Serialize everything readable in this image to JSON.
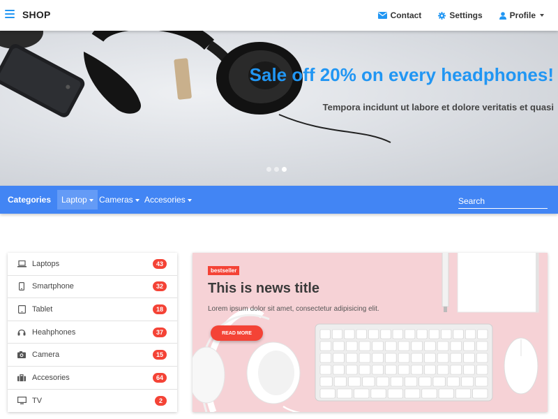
{
  "header": {
    "brand": "SHOP",
    "nav": [
      {
        "label": "Contact",
        "icon": "envelope-icon"
      },
      {
        "label": "Settings",
        "icon": "gear-icon"
      },
      {
        "label": "Profile",
        "icon": "user-icon"
      }
    ]
  },
  "hero": {
    "title": "Sale off 20% on every headphones!",
    "subtitle": "Tempora incidunt ut labore et dolore veritatis et quasi",
    "slides": 3,
    "active_slide": 3
  },
  "categories_bar": {
    "label": "Categories",
    "items": [
      {
        "label": "Laptop",
        "active": true
      },
      {
        "label": "Cameras",
        "active": false
      },
      {
        "label": "Accesories",
        "active": false
      }
    ],
    "search_placeholder": "Search"
  },
  "category_list": [
    {
      "label": "Laptops",
      "count": "43",
      "icon": "laptop-icon"
    },
    {
      "label": "Smartphone",
      "count": "32",
      "icon": "smartphone-icon"
    },
    {
      "label": "Tablet",
      "count": "18",
      "icon": "tablet-icon"
    },
    {
      "label": "Heahphones",
      "count": "37",
      "icon": "headphones-icon"
    },
    {
      "label": "Camera",
      "count": "15",
      "icon": "camera-icon"
    },
    {
      "label": "Accesories",
      "count": "64",
      "icon": "briefcase-icon"
    },
    {
      "label": "TV",
      "count": "2",
      "icon": "tv-icon"
    }
  ],
  "news": {
    "tag": "bestseller",
    "title": "This is news title",
    "description": "Lorem ipsum dolor sit amet, consectetur adipisicing elit.",
    "button": "READ MORE"
  },
  "colors": {
    "primary": "#2196f3",
    "categories_bar": "#4285f4",
    "badge": "#f44336",
    "news_bg": "#f6d2d6"
  }
}
